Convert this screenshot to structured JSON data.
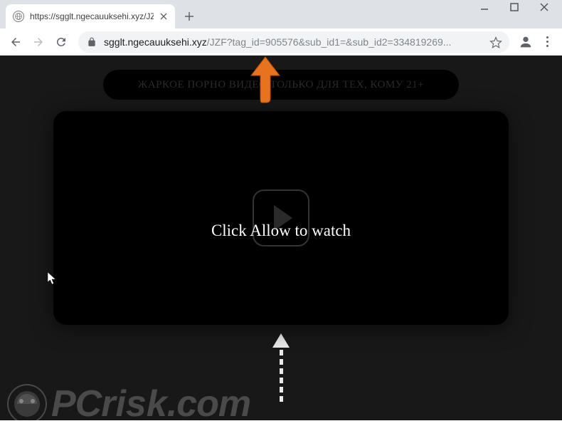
{
  "window": {
    "minimize": "—",
    "maximize": "□",
    "close": "×"
  },
  "tab": {
    "title": "https://sgglt.ngecauuksehi.xyz/JZ",
    "close": "×"
  },
  "newTab": "+",
  "address": {
    "domain": "sgglt.ngecauuksehi.xyz",
    "path": "/JZF?tag_id=905576&sub_id1=&sub_id2=334819269..."
  },
  "page": {
    "banner": "ЖАРКОЕ ПОРНО ВИДЕО ТОЛЬКО ДЛЯ ТЕХ, КОМУ 21+",
    "overlay": "Click Allow to watch"
  },
  "watermark": {
    "pc": "PC",
    "risk": "risk",
    "dot": ".",
    "com": "com"
  }
}
